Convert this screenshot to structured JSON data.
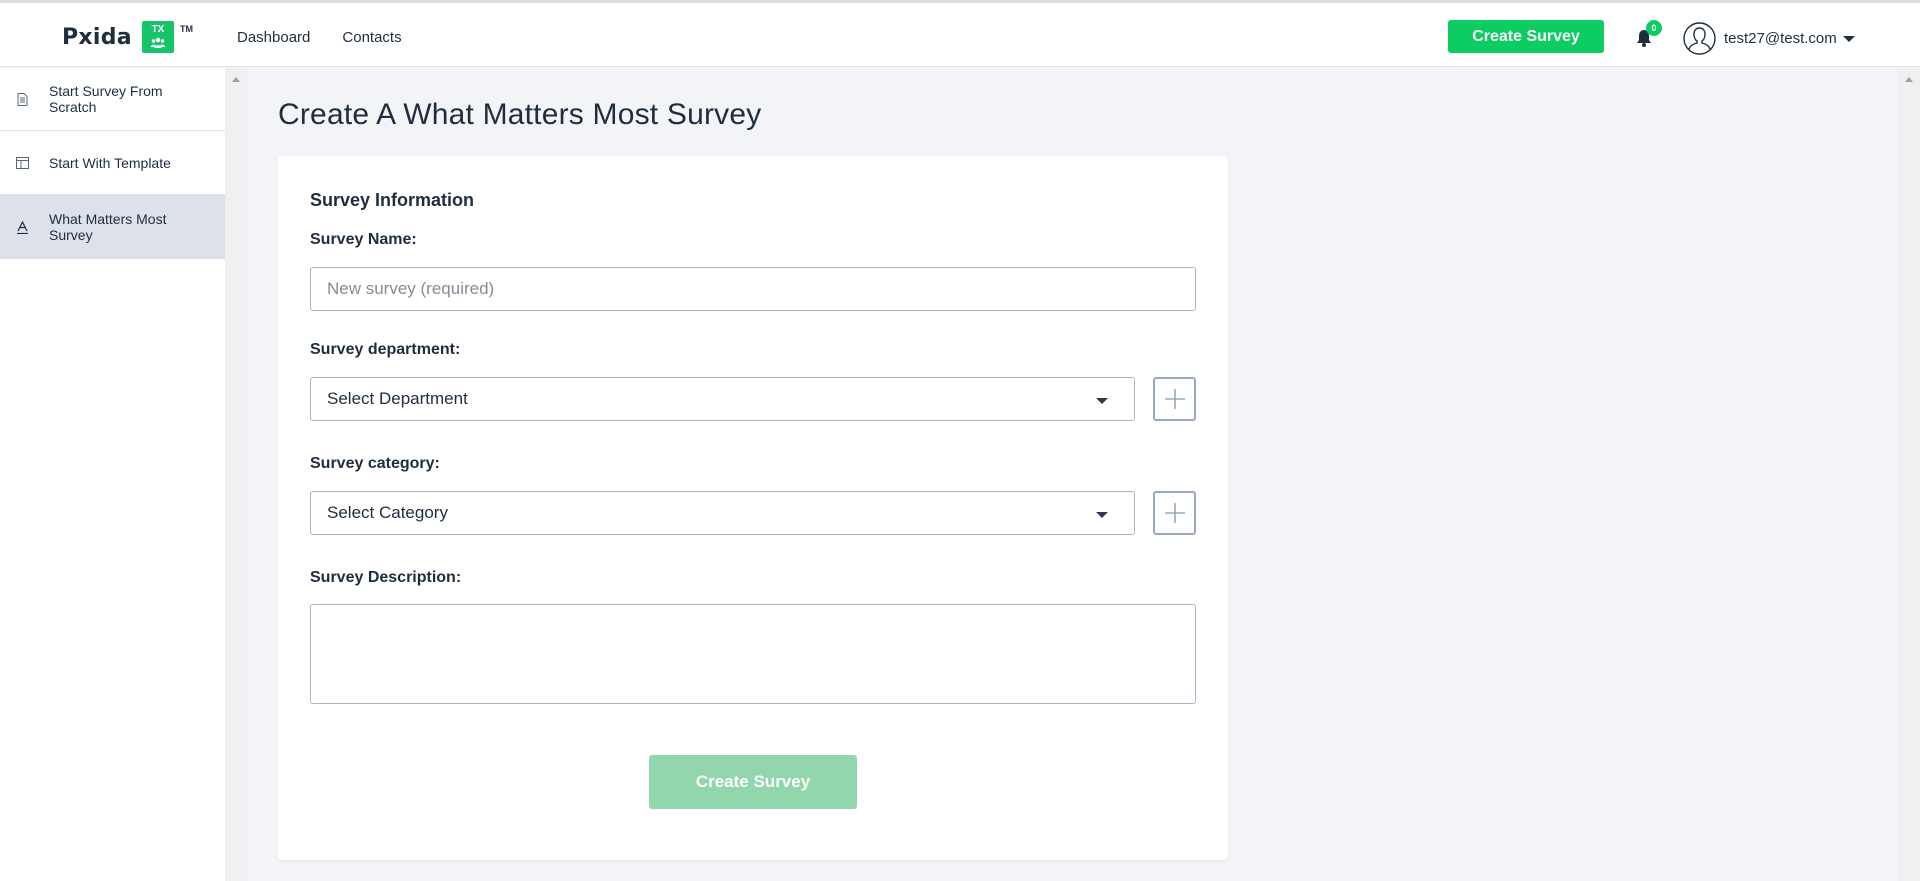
{
  "header": {
    "logo": {
      "text": "Pxida",
      "badge": "TX",
      "trademark": "TM"
    },
    "nav": [
      {
        "label": "Dashboard"
      },
      {
        "label": "Contacts"
      }
    ],
    "create_survey_label": "Create Survey",
    "notifications_count": "0",
    "user_email": "test27@test.com"
  },
  "sidebar": {
    "items": [
      {
        "label": "Start Survey From Scratch",
        "icon": "document-icon",
        "active": false
      },
      {
        "label": "Start With Template",
        "icon": "template-icon",
        "active": false
      },
      {
        "label": "What Matters Most Survey",
        "icon": "text-a-icon",
        "active": true
      }
    ]
  },
  "main": {
    "title": "Create A What Matters Most Survey",
    "section_title": "Survey Information",
    "fields": {
      "name": {
        "label": "Survey Name:",
        "value": "",
        "placeholder": "New survey (required)"
      },
      "department": {
        "label": "Survey department:",
        "selected": "Select Department"
      },
      "category": {
        "label": "Survey category:",
        "selected": "Select Category"
      },
      "description": {
        "label": "Survey Description:",
        "value": ""
      }
    },
    "submit_label": "Create Survey"
  },
  "colors": {
    "brand_green": "#0ccc62",
    "disabled_green": "#92d6ae",
    "sidebar_active": "#dde2ea",
    "text_dark": "#1f2d3d"
  }
}
